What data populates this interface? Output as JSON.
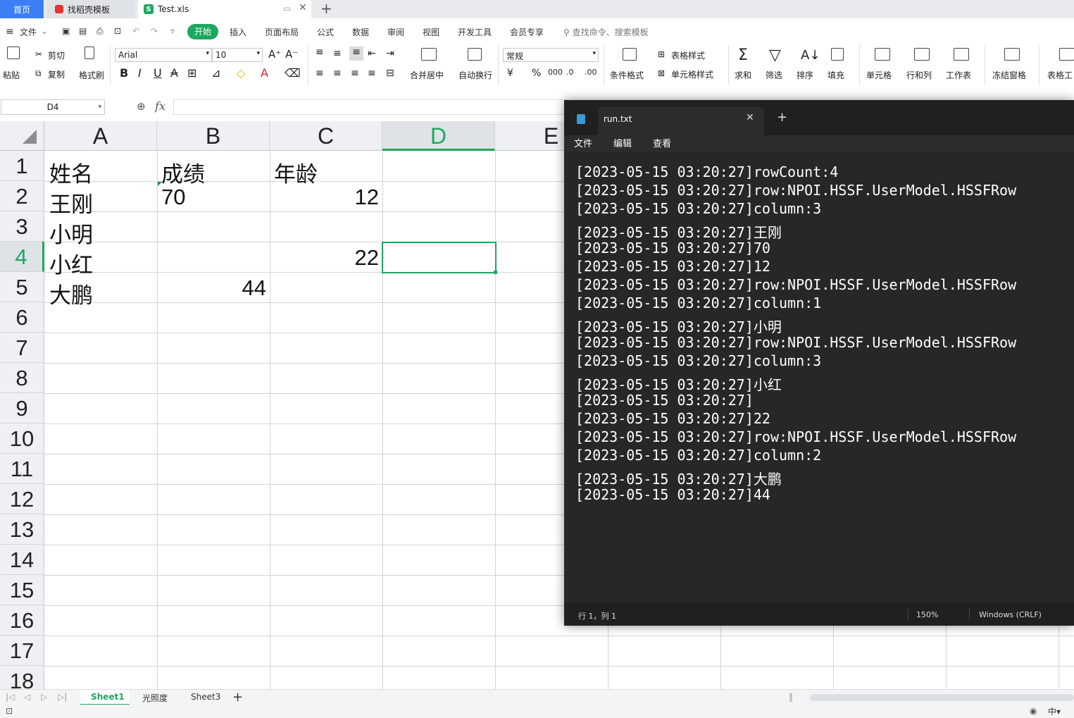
{
  "tabs": {
    "home": "首页",
    "template": "找稻壳模板",
    "file": "Test.xls"
  },
  "menu": {
    "file": "文件",
    "items": [
      "开始",
      "插入",
      "页面布局",
      "公式",
      "数据",
      "审阅",
      "视图",
      "开发工具",
      "会员专享"
    ],
    "search": "查找命令、搜索模板"
  },
  "ribbon": {
    "paste": "粘贴",
    "cut": "剪切",
    "copy": "复制",
    "format_painter": "格式刷",
    "font": "Arial",
    "size": "10",
    "merge": "合并居中",
    "wrap": "自动换行",
    "numfmt": "常规",
    "table_style": "表格样式",
    "cond_format": "条件格式",
    "cell_style": "单元格样式",
    "sum": "求和",
    "filter": "筛选",
    "sort": "排序",
    "fill": "填充",
    "cell": "单元格",
    "rowcol": "行和列",
    "sheet": "工作表",
    "freeze": "冻结窗格",
    "tabletool": "表格工"
  },
  "namebox": "D4",
  "fx": "fx",
  "columns": [
    "A",
    "B",
    "C",
    "D",
    "E"
  ],
  "rows": [
    "1",
    "2",
    "3",
    "4",
    "5",
    "6",
    "7",
    "8",
    "9",
    "10",
    "11",
    "12",
    "13",
    "14",
    "15",
    "16",
    "17",
    "18"
  ],
  "cells": {
    "A1": "姓名",
    "B1": "成绩",
    "C1": "年龄",
    "A2": "王刚",
    "B2": "70",
    "C2": "12",
    "A3": "小明",
    "A4": "小红",
    "C4": "22",
    "A5": "大鹏",
    "B5": "44"
  },
  "sheets": [
    "Sheet1",
    "光照度",
    "Sheet3"
  ],
  "notepad": {
    "tab": "run.txt",
    "menu": [
      "文件",
      "编辑",
      "查看"
    ],
    "lines": [
      "[2023-05-15 03:20:27]rowCount:4",
      "[2023-05-15 03:20:27]row:NPOI.HSSF.UserModel.HSSFRow",
      "[2023-05-15 03:20:27]column:3",
      "[2023-05-15 03:20:27]王刚",
      "[2023-05-15 03:20:27]70",
      "[2023-05-15 03:20:27]12",
      "[2023-05-15 03:20:27]row:NPOI.HSSF.UserModel.HSSFRow",
      "[2023-05-15 03:20:27]column:1",
      "[2023-05-15 03:20:27]小明",
      "[2023-05-15 03:20:27]row:NPOI.HSSF.UserModel.HSSFRow",
      "[2023-05-15 03:20:27]column:3",
      "[2023-05-15 03:20:27]小红",
      "[2023-05-15 03:20:27]",
      "[2023-05-15 03:20:27]22",
      "[2023-05-15 03:20:27]row:NPOI.HSSF.UserModel.HSSFRow",
      "[2023-05-15 03:20:27]column:2",
      "[2023-05-15 03:20:27]大鹏",
      "[2023-05-15 03:20:27]44"
    ],
    "status": {
      "pos": "行 1，列 1",
      "zoom": "150%",
      "eol": "Windows (CRLF)"
    }
  }
}
